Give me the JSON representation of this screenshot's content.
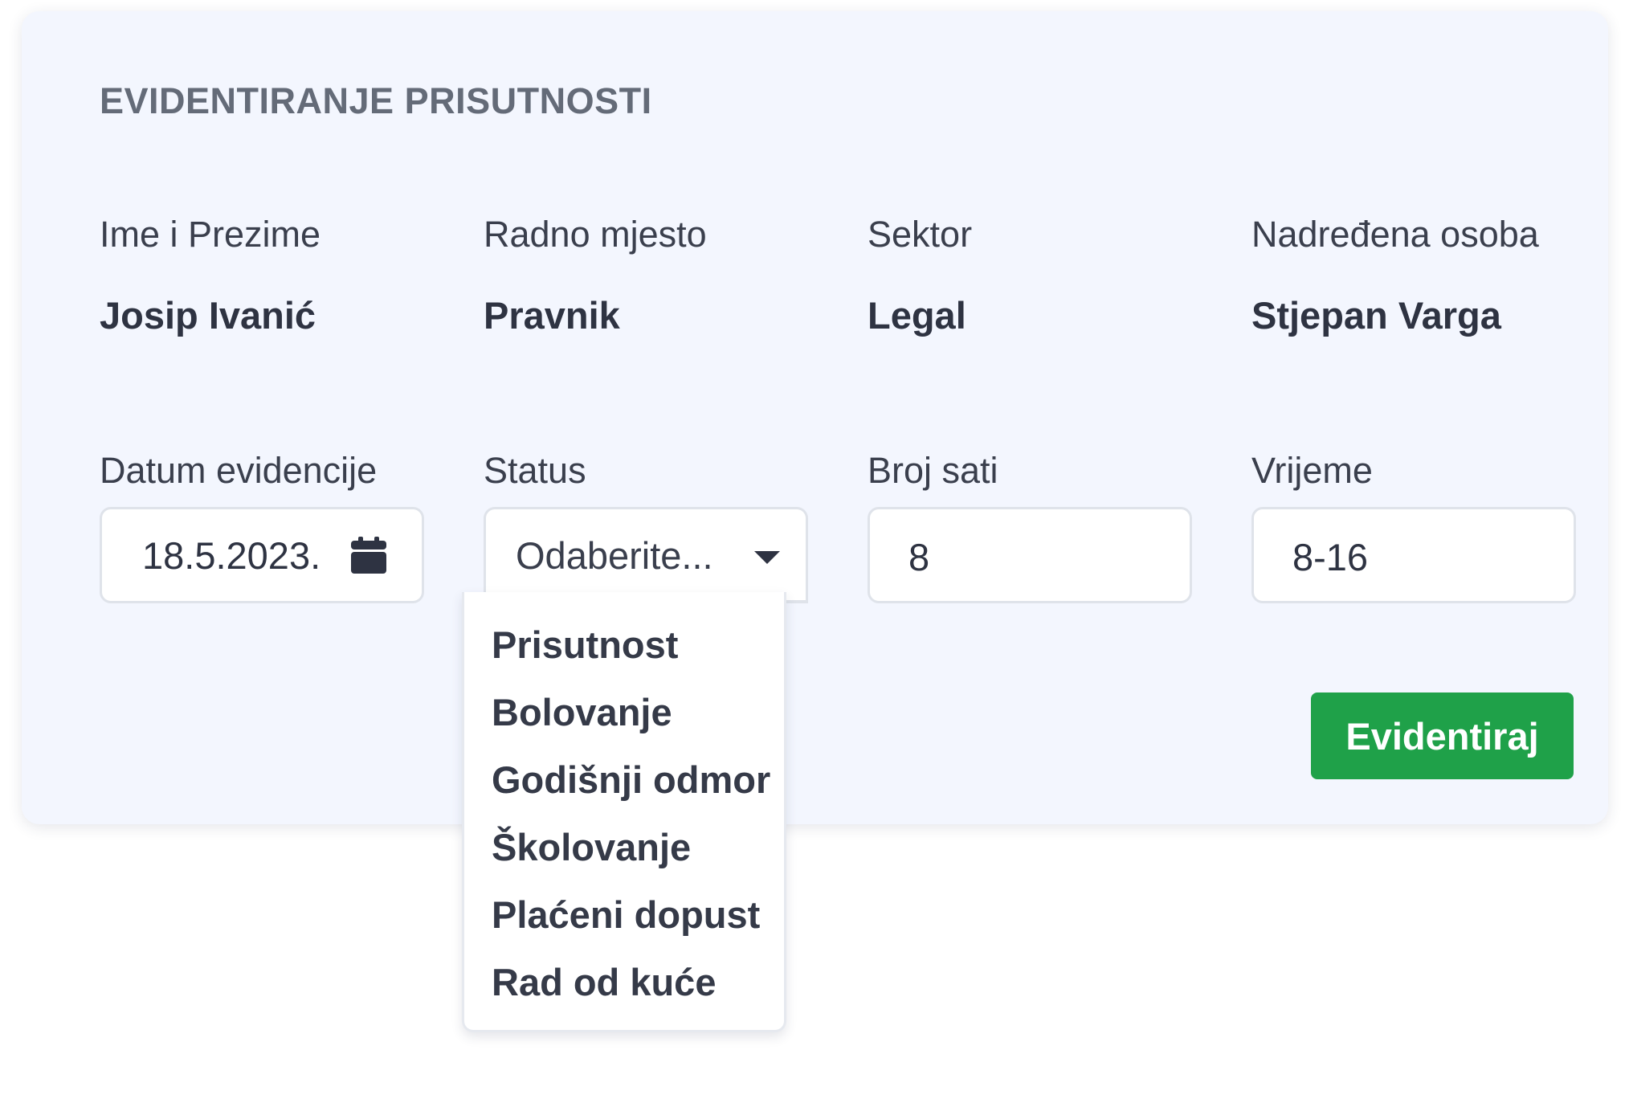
{
  "card": {
    "title": "EVIDENTIRANJE PRISUTNOSTI"
  },
  "employee": {
    "name_label": "Ime i Prezime",
    "name_value": "Josip Ivanić",
    "position_label": "Radno mjesto",
    "position_value": "Pravnik",
    "sector_label": "Sektor",
    "sector_value": "Legal",
    "supervisor_label": "Nadređena osoba",
    "supervisor_value": "Stjepan Varga"
  },
  "form": {
    "date_label": "Datum evidencije",
    "date_value": "18.5.2023.",
    "date_icon": "calendar-icon",
    "status_label": "Status",
    "status_placeholder": "Odaberite...",
    "status_icon": "chevron-down-icon",
    "status_options": [
      "Prisutnost",
      "Bolovanje",
      "Godišnji odmor",
      "Školovanje",
      "Plaćeni dopust",
      "Rad od kuće"
    ],
    "hours_label": "Broj sati",
    "hours_value": "8",
    "time_label": "Vrijeme",
    "time_value": "8-16",
    "submit_label": "Evidentiraj"
  },
  "colors": {
    "card_background": "#f3f6fe",
    "submit_button": "#1fa149",
    "title_text": "#646b78",
    "body_text": "#2e3342"
  }
}
